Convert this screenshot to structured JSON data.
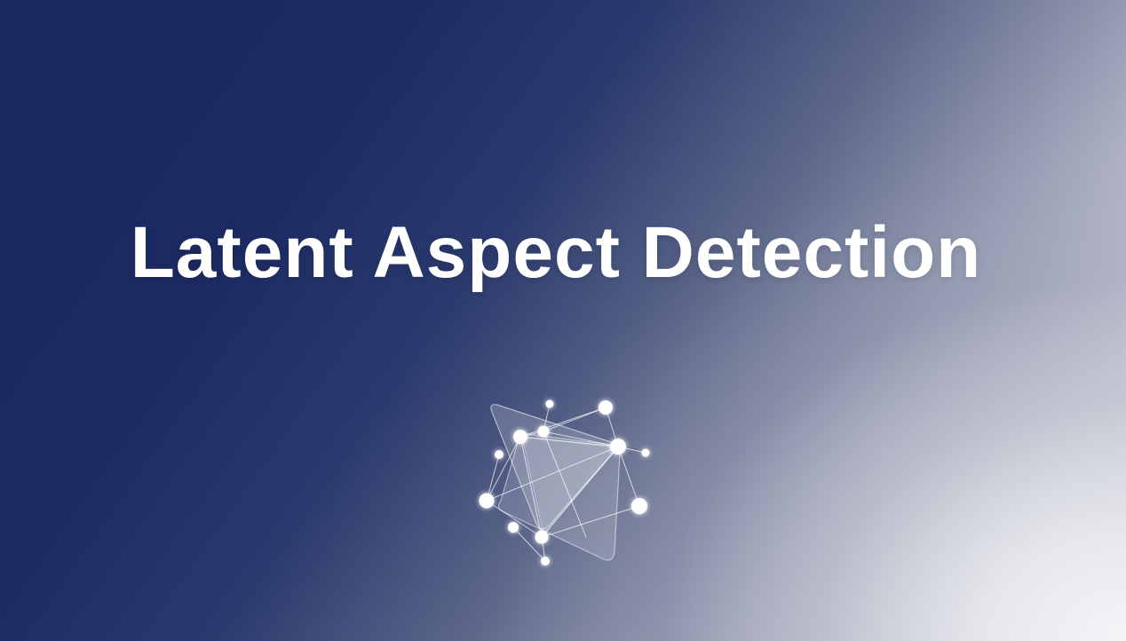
{
  "slide": {
    "title": "Latent Aspect Detection",
    "logo_icon": "network-graph-icon",
    "colors": {
      "background_dark": "#1a2860",
      "background_light": "#f0f0f2",
      "title": "#ffffff"
    }
  }
}
